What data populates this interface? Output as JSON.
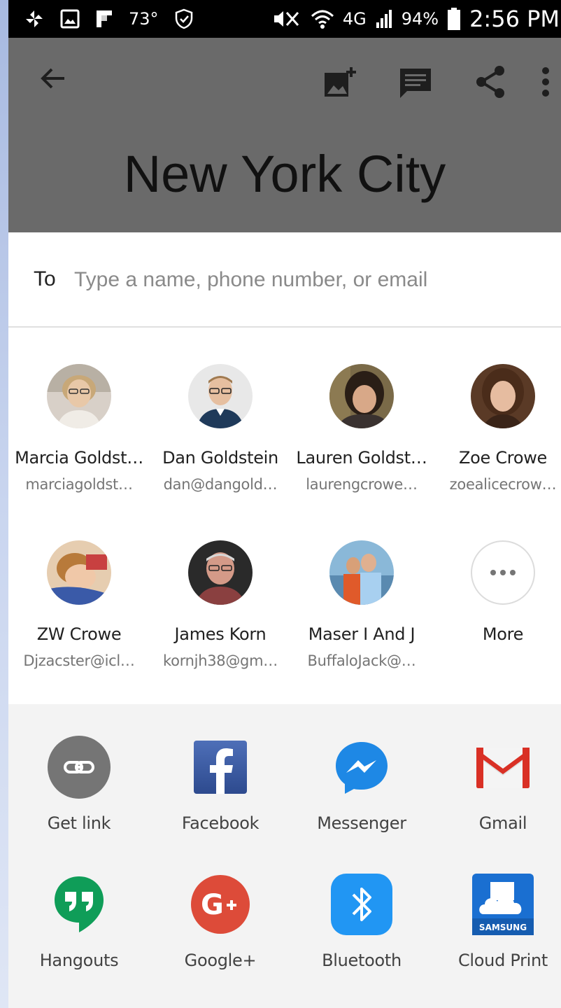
{
  "status_bar": {
    "temperature": "73°",
    "network": "4G",
    "battery": "94%",
    "time": "2:56 PM"
  },
  "app": {
    "title": "New York City"
  },
  "share": {
    "to_label": "To",
    "to_placeholder": "Type a name, phone number, or email",
    "contacts": [
      {
        "name": "Marcia Goldst…",
        "email": "marciagoldst…",
        "avatar": "person-photo-icon"
      },
      {
        "name": "Dan Goldstein",
        "email": "dan@dangold…",
        "avatar": "person-photo-icon"
      },
      {
        "name": "Lauren Goldst…",
        "email": "laurengcrowe…",
        "avatar": "person-photo-icon"
      },
      {
        "name": "Zoe  Crowe",
        "email": "zoealicecrow…",
        "avatar": "person-photo-icon"
      },
      {
        "name": "ZW Crowe",
        "email": "Djzacster@icl…",
        "avatar": "person-photo-icon"
      },
      {
        "name": "James Korn",
        "email": "kornjh38@gm…",
        "avatar": "person-photo-icon"
      },
      {
        "name": "Maser I And J",
        "email": "BuffaloJack@…",
        "avatar": "person-photo-icon"
      }
    ],
    "more_label": "More",
    "apps": [
      {
        "label": "Get link",
        "icon": "link-icon"
      },
      {
        "label": "Facebook",
        "icon": "facebook-icon"
      },
      {
        "label": "Messenger",
        "icon": "messenger-icon"
      },
      {
        "label": "Gmail",
        "icon": "gmail-icon"
      },
      {
        "label": "Hangouts",
        "icon": "hangouts-icon"
      },
      {
        "label": "Google+",
        "icon": "google-plus-icon"
      },
      {
        "label": "Bluetooth",
        "icon": "bluetooth-icon"
      },
      {
        "label": "Cloud Print",
        "icon": "cloud-print-icon"
      }
    ],
    "cloud_print_badge": "SAMSUNG"
  },
  "colors": {
    "facebook": "#3b5998",
    "messenger": "#1e88e5",
    "gmail_red": "#d93025",
    "hangouts": "#0f9d58",
    "google_plus": "#dd4b39",
    "bluetooth": "#2196f3",
    "cloud_print": "#1a6fd1",
    "get_link": "#757575"
  }
}
